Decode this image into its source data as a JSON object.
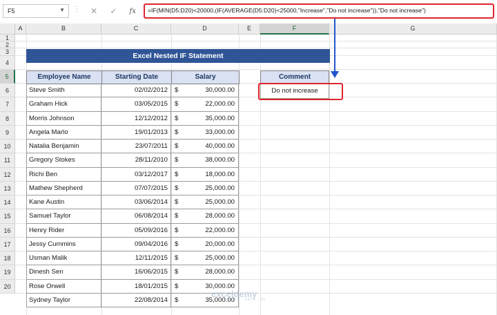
{
  "formula_bar": {
    "name_box": "F5",
    "cancel_icon": "✕",
    "enter_icon": "✓",
    "fx_label": "fx",
    "formula": "=IF(MIN(D5:D20)<20000,(IF(AVERAGE(D5:D20)<25000,\"Increase\",\"Do not increase\")),\"Do not increase\")"
  },
  "columns": [
    "A",
    "B",
    "C",
    "D",
    "E",
    "F",
    "G"
  ],
  "rows": [
    "1",
    "2",
    "3",
    "4",
    "5",
    "6",
    "7",
    "8",
    "9",
    "10",
    "11",
    "12",
    "13",
    "14",
    "15",
    "16",
    "17",
    "18",
    "19",
    "20"
  ],
  "title": "Excel Nested IF Statement",
  "table": {
    "headers": [
      "Employee Name",
      "Starting Date",
      "Salary"
    ],
    "currency": "$",
    "rows": [
      {
        "name": "Steve Smith",
        "date": "02/02/2012",
        "salary": "30,000.00"
      },
      {
        "name": "Graham Hick",
        "date": "03/05/2015",
        "salary": "22,000.00"
      },
      {
        "name": "Morris Johnson",
        "date": "12/12/2012",
        "salary": "35,000.00"
      },
      {
        "name": "Angela Marlo",
        "date": "19/01/2013",
        "salary": "33,000.00"
      },
      {
        "name": "Natalia Benjamin",
        "date": "23/07/2011",
        "salary": "40,000.00"
      },
      {
        "name": "Gregory Stokes",
        "date": "28/11/2010",
        "salary": "38,000.00"
      },
      {
        "name": "Richi Ben",
        "date": "03/12/2017",
        "salary": "18,000.00"
      },
      {
        "name": "Mathew Shepherd",
        "date": "07/07/2015",
        "salary": "25,000.00"
      },
      {
        "name": "Kane Austin",
        "date": "03/06/2014",
        "salary": "25,000.00"
      },
      {
        "name": "Samuel Taylor",
        "date": "06/08/2014",
        "salary": "28,000.00"
      },
      {
        "name": "Henry Rider",
        "date": "05/09/2016",
        "salary": "22,000.00"
      },
      {
        "name": "Jessy Cummins",
        "date": "09/04/2016",
        "salary": "20,000.00"
      },
      {
        "name": "Usman Malik",
        "date": "12/11/2015",
        "salary": "25,000.00"
      },
      {
        "name": "Dinesh Sen",
        "date": "16/06/2015",
        "salary": "28,000.00"
      },
      {
        "name": "Rose Orwell",
        "date": "18/01/2015",
        "salary": "30,000.00"
      },
      {
        "name": "Sydney Taylor",
        "date": "22/08/2014",
        "salary": "35,000.00"
      }
    ]
  },
  "comment": {
    "header": "Comment",
    "value": "Do not increase"
  },
  "watermark": {
    "brand": "exceldemy",
    "tagline": "EXCEL · DATA · BI"
  },
  "colors": {
    "title_bg": "#2f5597",
    "header_bg": "#d9e1f2",
    "highlight": "#e0242d",
    "arrow": "#2255cc"
  }
}
